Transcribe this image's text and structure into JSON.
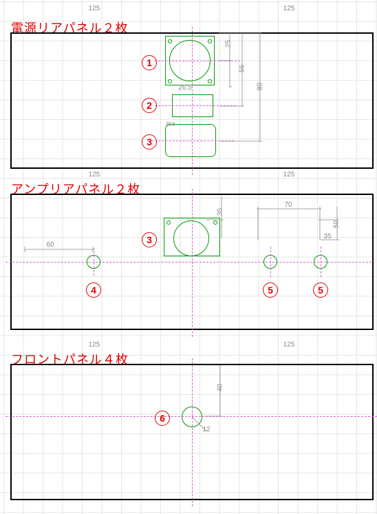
{
  "panels": {
    "p1": {
      "title": "電源リアパネル２枚"
    },
    "p2": {
      "title": "アンプリアパネル２枚"
    },
    "p3": {
      "title": "フロントパネル４枚"
    }
  },
  "labels": {
    "l1": "1",
    "l2": "2",
    "l3": "3",
    "l4": "3",
    "l5": "4",
    "l6": "5",
    "l7": "5",
    "l8": "6"
  },
  "dims": {
    "d125a": "125",
    "d125b": "125",
    "d125c": "125",
    "d125d": "125",
    "d125e": "125",
    "d125f": "125",
    "d60": "60",
    "d70": "70",
    "d50": "50",
    "d35a": "35",
    "d35b": "35",
    "d80": "80",
    "d25": "25",
    "d55": "55",
    "d26_5": "26.5",
    "d40": "40",
    "d12": "12",
    "d856": "856"
  }
}
